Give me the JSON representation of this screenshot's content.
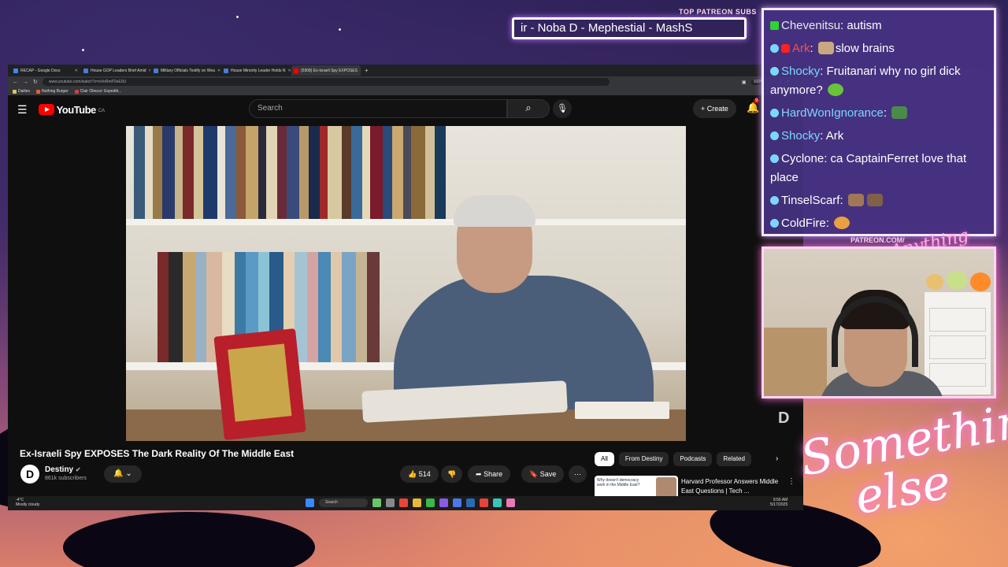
{
  "ticker": {
    "label": "TOP PATREON SUBS",
    "text": "ir - Noba D - Mephestial - MashS"
  },
  "browser": {
    "tabs": [
      {
        "label": "RECAP - Google Docs",
        "color": "#4285f4"
      },
      {
        "label": "House GOP Leaders Brief Amid",
        "color": "#4a7bd6"
      },
      {
        "label": "Military Officials Testify on Wea",
        "color": "#4a7bd6"
      },
      {
        "label": "House Minority Leader Holds N",
        "color": "#4a7bd6"
      },
      {
        "label": "(5908) Ex-Israeli Spy EXPOSES",
        "color": "#ff0000"
      }
    ],
    "new_tab": "+",
    "url": "www.youtube.com/watch?v=eVeRmP2eE0U",
    "zoom": "160%",
    "bookmarks": [
      {
        "label": "Dailies",
        "color": "#e0c060"
      },
      {
        "label": "Nothing Burger",
        "color": "#e06030"
      },
      {
        "label": "Clair Obscur: Expediti...",
        "color": "#d04040"
      }
    ]
  },
  "youtube": {
    "logo_text": "YouTube",
    "country": "CA",
    "search_placeholder": "Search",
    "create_label": "Create",
    "notification_count": "9",
    "video_title": "Ex-Israeli Spy EXPOSES The Dark Reality Of The Middle East",
    "channel": {
      "name": "Destiny",
      "subscribers": "861k subscribers",
      "avatar_letter": "D"
    },
    "likes": "514",
    "share_label": "Share",
    "save_label": "Save",
    "chips": [
      "All",
      "From Destiny",
      "Podcasts",
      "Related"
    ],
    "recommendation": {
      "thumb_text": "Why doesn't democracy work in the Middle East?",
      "title": "Harvard Professor Answers Middle East Questions | Tech ..."
    }
  },
  "taskbar": {
    "weather_temp": "-4°C",
    "weather_desc": "Mostly cloudy",
    "search_label": "Search",
    "time": "9:56 AM",
    "date": "5/17/2025"
  },
  "chat": [
    {
      "user": "Chevenitsu",
      "text": "autism",
      "color": "#e8e8e8",
      "badge": "#2fd52f"
    },
    {
      "user": "Ark",
      "text": "slow brains",
      "color": "#ff4a4a",
      "badge": "#ff2020",
      "emote": true
    },
    {
      "user": "Shocky",
      "text": "Fruitanari why no girl dick anymore?",
      "color": "#7ad8ff",
      "badge": "#7ad8ff",
      "emote_end": true
    },
    {
      "user": "HardWonIgnorance",
      "text": "",
      "color": "#7ad8ff",
      "badge": "#7ad8ff",
      "emote_end": true
    },
    {
      "user": "Shocky",
      "text": "Ark",
      "color": "#7ad8ff",
      "badge": "#7ad8ff"
    },
    {
      "user": "Cyclone",
      "text": "ca CaptainFerret love that place",
      "color": "#ffffff",
      "badge": "#7ad8ff"
    },
    {
      "user": "TinselScarf",
      "text": "",
      "color": "#ffffff",
      "badge": "#7ad8ff",
      "emote_end": true
    },
    {
      "user": "ColdFire",
      "text": "",
      "color": "#ffffff",
      "badge": "#7ad8ff",
      "emote_end": true
    }
  ],
  "overlay": {
    "patreon_label": "PATREON.COM/",
    "patreon_handle": "Anything else",
    "signature_line1": "Something",
    "signature_line2": "else"
  }
}
